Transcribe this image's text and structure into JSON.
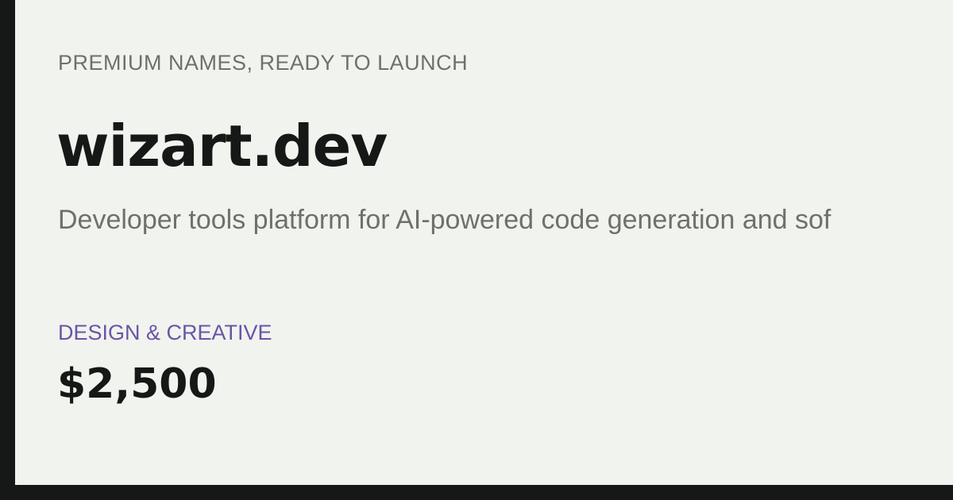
{
  "listing": {
    "eyebrow": "PREMIUM NAMES, READY TO LAUNCH",
    "domain_name": "wizart.dev",
    "description": "Developer tools platform for AI-powered code generation and sof",
    "category": "DESIGN & CREATIVE",
    "price": "$2,500"
  },
  "colors": {
    "background": "#f1f3ee",
    "frame": "#151816",
    "muted_text": "#6d716d",
    "accent": "#6a54a8",
    "primary_text": "#151816"
  }
}
